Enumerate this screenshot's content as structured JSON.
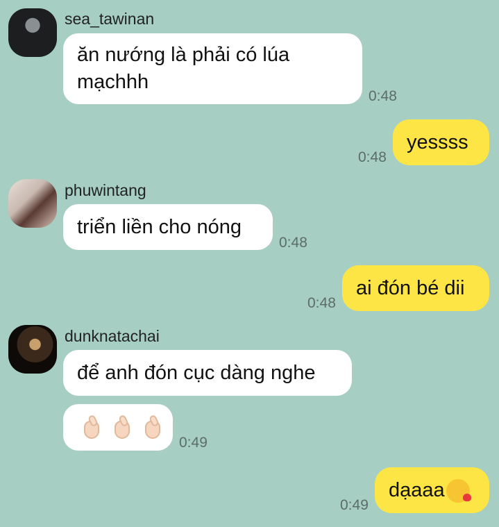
{
  "messages": [
    {
      "sender": "sea_tawinan",
      "text_line1": "ăn nướng là phải có lúa",
      "text_line2": "mạchhh",
      "time": "0:48"
    },
    {
      "sender": "me",
      "text": "yessss",
      "time": "0:48"
    },
    {
      "sender": "phuwintang",
      "text": "triển liền cho nóng",
      "time": "0:48"
    },
    {
      "sender": "me",
      "text": "ai đón bé dii",
      "time": "0:48"
    },
    {
      "sender": "dunknatachai",
      "text": "để anh đón cục dàng nghe"
    },
    {
      "sender": "dunknatachai",
      "emoji": "finger-heart x3",
      "time": "0:49"
    },
    {
      "sender": "me",
      "text": "dạaaa",
      "emoji": "kissing-face-with-heart",
      "time": "0:49"
    }
  ],
  "colors": {
    "background": "#a6cec3",
    "incoming": "#ffffff",
    "outgoing": "#fde545"
  }
}
